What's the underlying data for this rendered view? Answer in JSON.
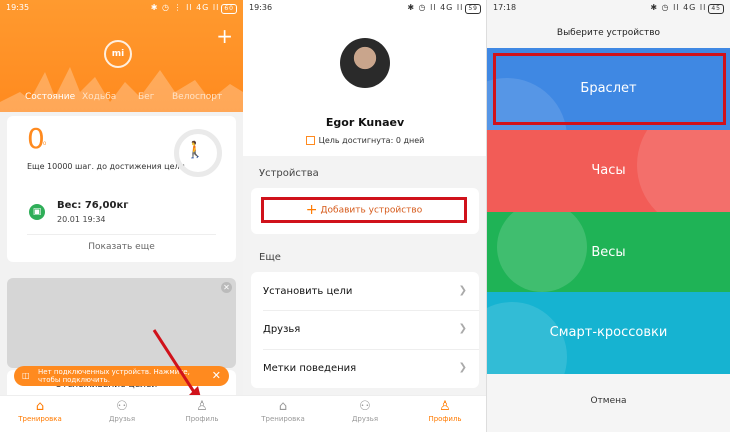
{
  "panel1": {
    "status_time": "19:35",
    "status_right": "✱ ◷ ⋮ ll 4G ll",
    "battery": "60",
    "logo_text": "mi",
    "tabs": [
      "Состояние",
      "Ходьба",
      "Бег",
      "Велоспорт"
    ],
    "steps_value": "0",
    "steps_unit": "₀",
    "goal_text": "Еще 10000 шаг. до достижения цели",
    "weight_label": "Вес: 76,00кг",
    "weight_date": "20.01 19:34",
    "show_more": "Показать еще",
    "toast_text_1": "Нет подключенных устройств. Нажмите,",
    "toast_text_2": "чтобы подключить.",
    "tracking_text": "Отслеживание целей",
    "nav": [
      "Тренировка",
      "Друзья",
      "Профиль"
    ],
    "accent": "#ff8a1f"
  },
  "panel2": {
    "status_time": "19:36",
    "status_right": "✱ ◷ ll 4G ll",
    "battery": "59",
    "name": "Egor Kunaev",
    "goal": "Цель достигнута: 0 дней",
    "devices_header": "Устройства",
    "add_device": "Добавить устройство",
    "more_header": "Еще",
    "menu": [
      "Установить цели",
      "Друзья",
      "Метки поведения"
    ],
    "nav": [
      "Тренировка",
      "Друзья",
      "Профиль"
    ]
  },
  "panel3": {
    "status_time": "17:18",
    "status_right": "✱ ◷ ll 4G ll",
    "battery": "45",
    "title": "Выберите устройство",
    "devices": [
      {
        "label": "Браслет",
        "color": "#3f88e3"
      },
      {
        "label": "Часы",
        "color": "#f25c57"
      },
      {
        "label": "Весы",
        "color": "#1fb356"
      },
      {
        "label": "Смарт-кроссовки",
        "color": "#16b3d1"
      }
    ],
    "cancel": "Отмена"
  }
}
